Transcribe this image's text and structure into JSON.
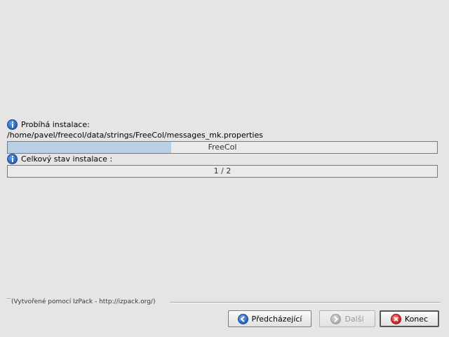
{
  "installer": {
    "status_label": "Probíhá instalace:",
    "current_file": "/home/pavel/freecol/data/strings/FreeCol/messages_mk.properties",
    "pack_progress": {
      "text": "FreeCol",
      "fraction": 0.38
    },
    "overall_label": "Celkový stav instalace :",
    "overall_progress": {
      "text": "1 / 2",
      "fraction": 0
    }
  },
  "footer": {
    "credit": "(Vytvořené pomocí IzPack - http://izpack.org/)"
  },
  "buttons": {
    "previous_label": "Předcházející",
    "next_label": "Další",
    "quit_label": "Konec"
  },
  "icons": {
    "status": "info-icon",
    "overall": "info-icon",
    "previous": "arrow-left-icon",
    "next": "arrow-right-icon",
    "quit": "close-icon"
  },
  "colors": {
    "progress_fill": "#b8cfe7",
    "background": "#e5e5e5"
  }
}
